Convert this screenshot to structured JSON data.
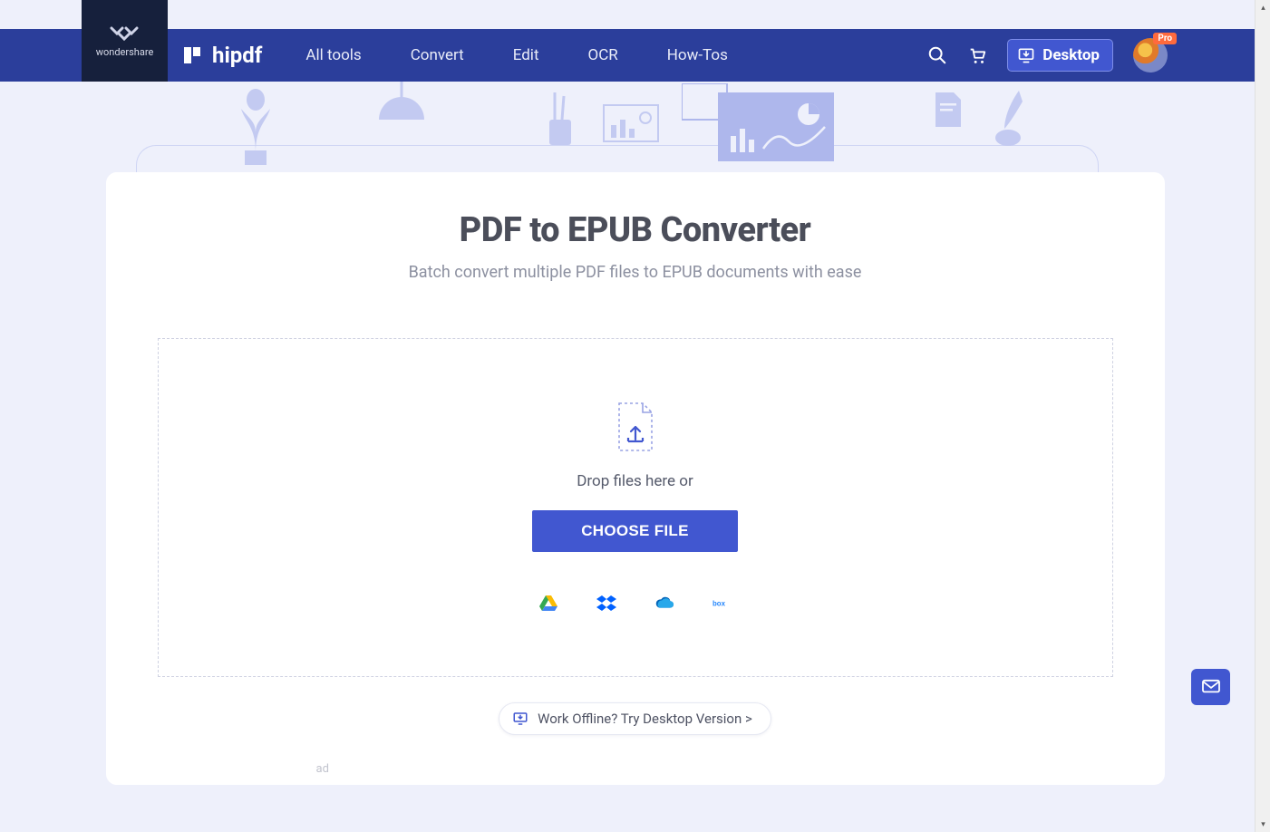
{
  "brand": {
    "wondershare": "wondershare",
    "product": "hipdf"
  },
  "nav": {
    "items": [
      "All tools",
      "Convert",
      "Edit",
      "OCR",
      "How-Tos"
    ],
    "desktop_label": "Desktop",
    "pro_badge": "Pro"
  },
  "page": {
    "title": "PDF to EPUB Converter",
    "subtitle": "Batch convert multiple PDF files to EPUB documents with ease",
    "drop_text": "Drop files here or",
    "choose_label": "CHOOSE FILE",
    "offline_text": "Work Offline? Try Desktop Version >",
    "ad_label": "ad"
  },
  "cloud_sources": [
    "google-drive",
    "dropbox",
    "onedrive",
    "box"
  ]
}
